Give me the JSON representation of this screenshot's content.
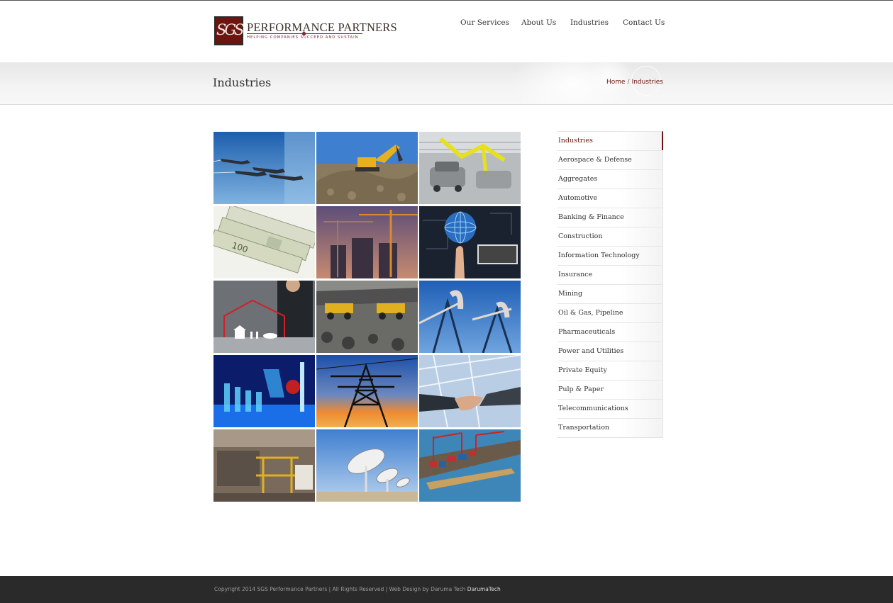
{
  "header": {
    "logo": {
      "monogram": "SGS",
      "name": "PERFORMANCE PARTNERS",
      "tagline": "HELPING COMPANIES SUCCEED AND SUSTAIN"
    },
    "nav": [
      {
        "label": "Our Services"
      },
      {
        "label": "About Us"
      },
      {
        "label": "Industries"
      },
      {
        "label": "Contact Us"
      }
    ]
  },
  "title_band": {
    "title": "Industries",
    "breadcrumb": {
      "home": "Home",
      "separator": "/",
      "current": "Industries"
    }
  },
  "grid": {
    "tiles": [
      {
        "icon": "fighter-jets-image"
      },
      {
        "icon": "excavator-image"
      },
      {
        "icon": "car-assembly-image"
      },
      {
        "icon": "money-bills-image"
      },
      {
        "icon": "construction-cranes-image"
      },
      {
        "icon": "globe-technology-image"
      },
      {
        "icon": "businessman-house-image"
      },
      {
        "icon": "mining-trucks-image"
      },
      {
        "icon": "oil-pumpjack-image"
      },
      {
        "icon": "lab-vials-image"
      },
      {
        "icon": "power-tower-image"
      },
      {
        "icon": "handshake-image"
      },
      {
        "icon": "paper-machine-image"
      },
      {
        "icon": "satellite-dishes-image"
      },
      {
        "icon": "cargo-port-image"
      }
    ]
  },
  "sidebar": {
    "items": [
      {
        "label": "Industries",
        "active": true
      },
      {
        "label": "Aerospace & Defense"
      },
      {
        "label": "Aggregates"
      },
      {
        "label": "Automotive"
      },
      {
        "label": "Banking & Finance"
      },
      {
        "label": "Construction"
      },
      {
        "label": "Information Technology"
      },
      {
        "label": "Insurance"
      },
      {
        "label": "Mining"
      },
      {
        "label": "Oil & Gas, Pipeline"
      },
      {
        "label": "Pharmaceuticals"
      },
      {
        "label": "Power and Utilities"
      },
      {
        "label": "Private Equity"
      },
      {
        "label": "Pulp & Paper"
      },
      {
        "label": "Telecommunications"
      },
      {
        "label": "Transportation"
      }
    ]
  },
  "footer": {
    "text": "Copyright 2014 SGS Performance Partners | All Rights Reserved | Web Design by Daruma Tech",
    "link": "DarumaTech"
  },
  "colors": {
    "brand": "#6b1410",
    "footer_bg": "#2a2a2a"
  }
}
